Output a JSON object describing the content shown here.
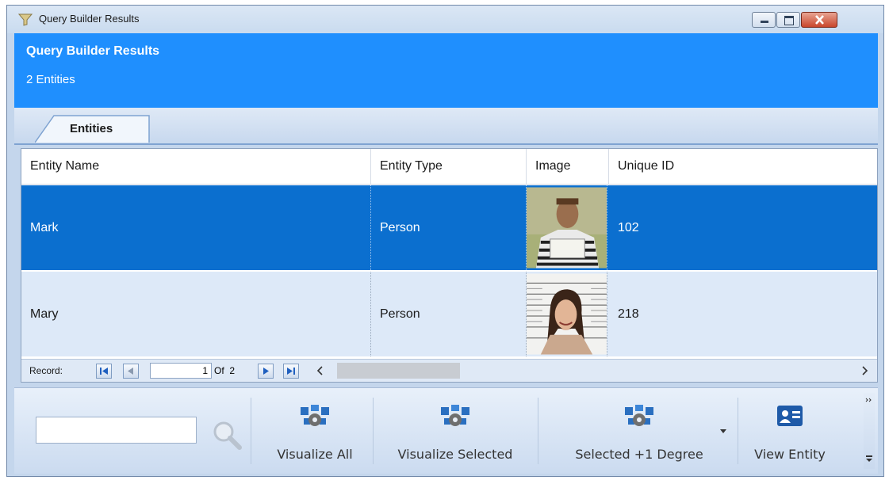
{
  "window": {
    "title": "Query Builder Results"
  },
  "header": {
    "title": "Query Builder Results",
    "subtitle": "2 Entities"
  },
  "tabs": [
    {
      "label": "Entities"
    }
  ],
  "grid": {
    "columns": [
      "Entity Name",
      "Entity Type",
      "Image",
      "Unique ID"
    ],
    "rows": [
      {
        "name": "Mark",
        "type": "Person",
        "id": "102",
        "selected": true
      },
      {
        "name": "Mary",
        "type": "Person",
        "id": "218",
        "selected": false
      }
    ]
  },
  "navigator": {
    "label": "Record:",
    "current": "1",
    "of_label": "Of",
    "total": "2"
  },
  "toolbar": {
    "search_value": "",
    "visualize_all": "Visualize All",
    "visualize_selected": "Visualize Selected",
    "selected_plus_one": "Selected +1 Degree",
    "view_entity": "View Entity"
  },
  "colors": {
    "header": "#1f8ffe",
    "selected_row": "#0b6fcf",
    "alt_row": "#dde9f8"
  },
  "icons": [
    "query-icon",
    "minimize-icon",
    "maximize-icon",
    "close-icon",
    "search-icon",
    "visualize-icon",
    "entity-card-icon"
  ]
}
